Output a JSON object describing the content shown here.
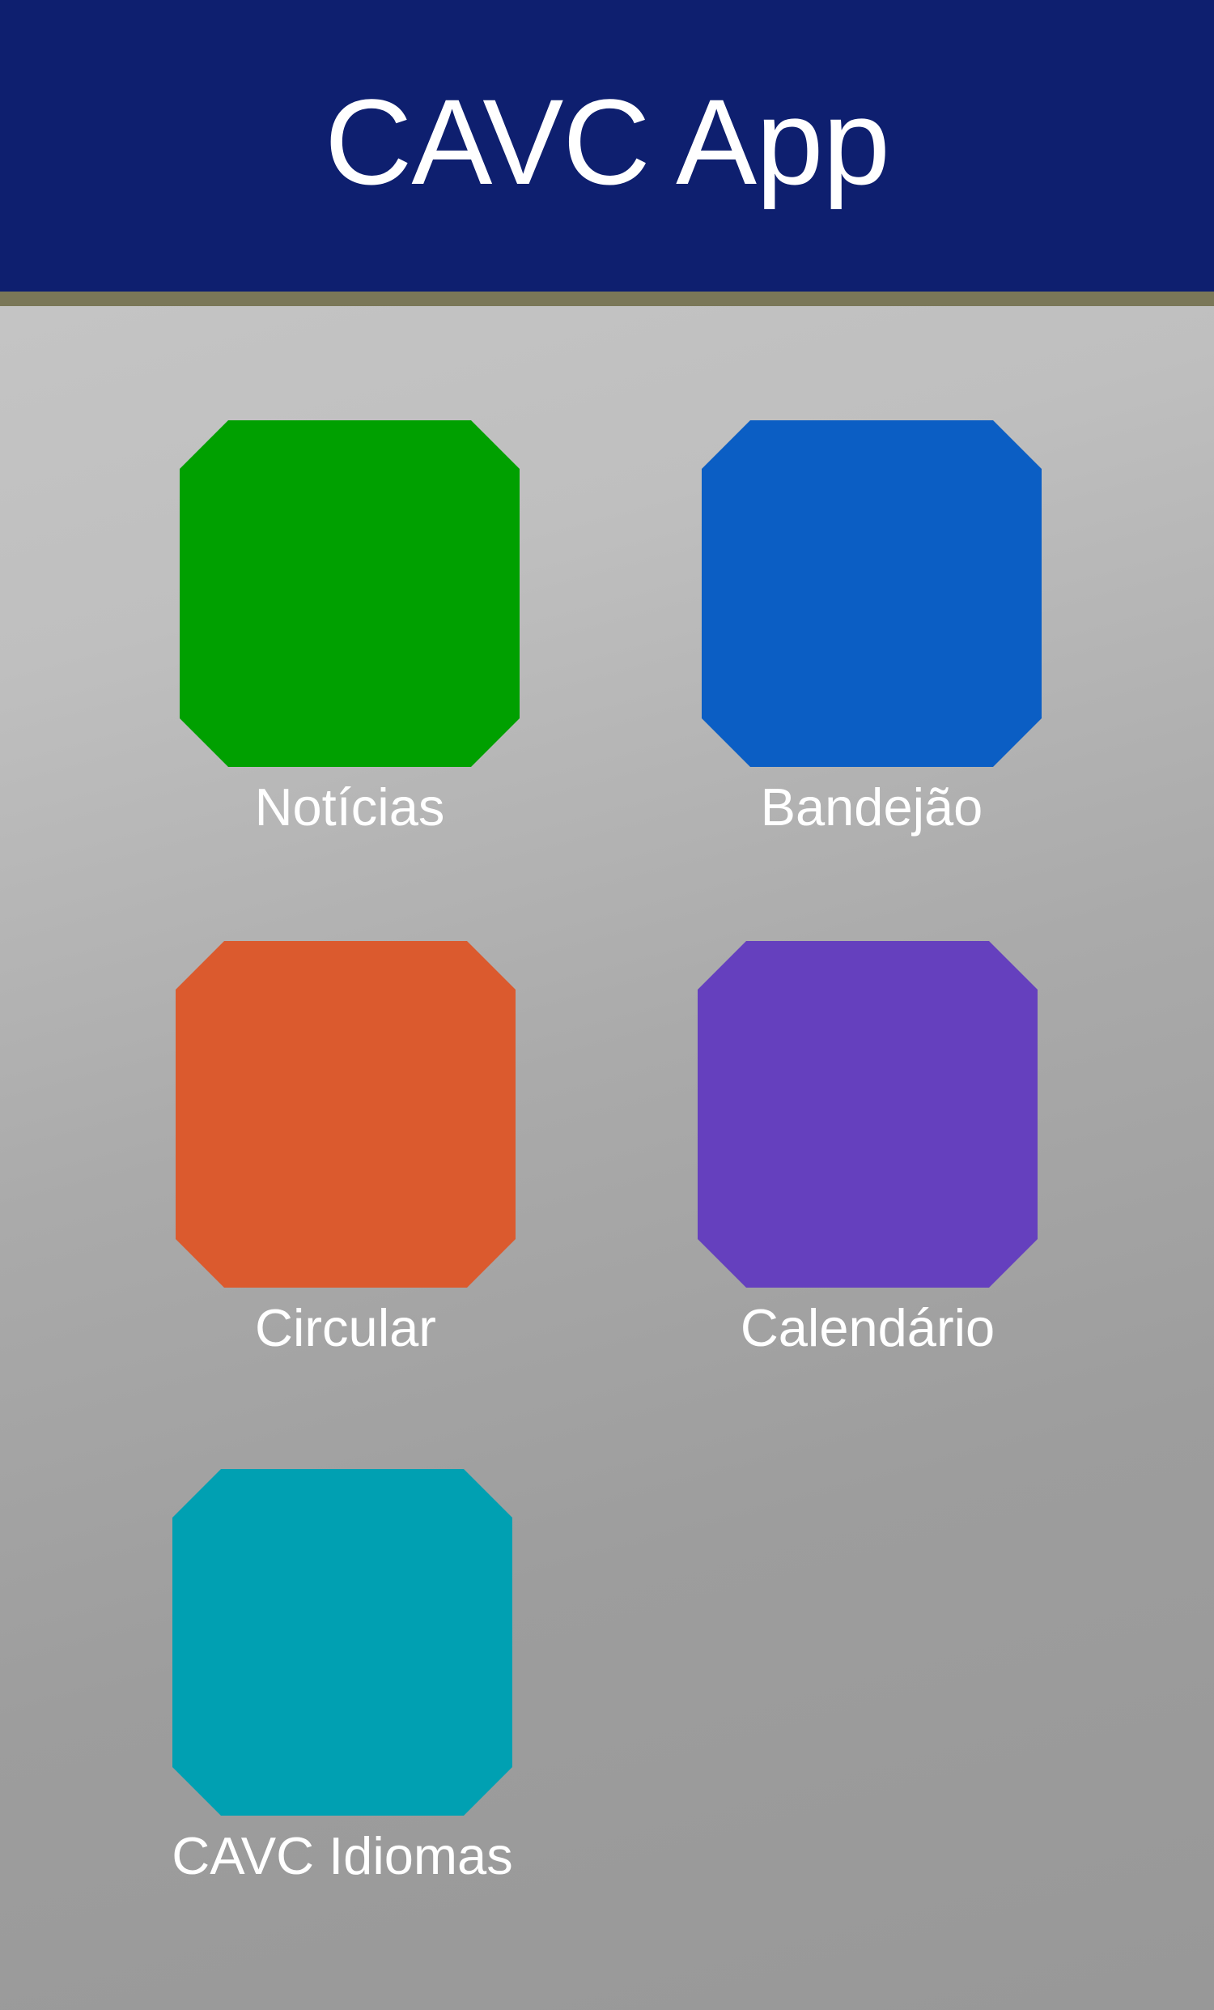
{
  "header": {
    "title": "CAVC App",
    "background_color": "#0e1f6f",
    "rule_color": "#7a7758"
  },
  "tiles": [
    {
      "label": "Notícias",
      "color": "#00a000"
    },
    {
      "label": "Bandejão",
      "color": "#0b5ec4"
    },
    {
      "label": "Circular",
      "color": "#db5a2e"
    },
    {
      "label": "Calendário",
      "color": "#6540be"
    },
    {
      "label": "CAVC Idiomas",
      "color": "#00a0b2"
    }
  ]
}
